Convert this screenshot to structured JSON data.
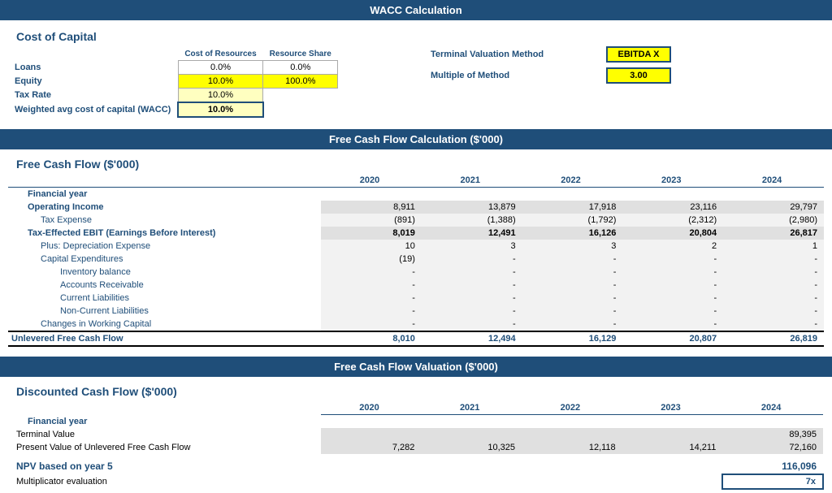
{
  "page": {
    "main_title": "WACC Calculation",
    "fcf_section_title": "Free Cash Flow Calculation ($'000)",
    "valuation_section_title": "Free Cash Flow Valuation ($'000)"
  },
  "wacc": {
    "subtitle": "Cost of Capital",
    "col_headers": {
      "cost_of_resources": "Cost of Resources",
      "resource_share": "Resource Share"
    },
    "rows": [
      {
        "label": "Loans",
        "cost": "0.0%",
        "share": "0.0%"
      },
      {
        "label": "Equity",
        "cost": "10.0%",
        "share": "100.0%"
      },
      {
        "label": "Tax Rate",
        "cost": "10.0%",
        "share": ""
      },
      {
        "label": "Weighted avg cost of capital (WACC)",
        "cost": "10.0%",
        "share": ""
      }
    ],
    "terminal_valuation_label": "Terminal Valuation Method",
    "terminal_valuation_value": "EBITDA X",
    "multiple_of_method_label": "Multiple of Method",
    "multiple_of_method_value": "3.00"
  },
  "fcf": {
    "subtitle": "Free Cash Flow ($'000)",
    "years": [
      "2020",
      "2021",
      "2022",
      "2023",
      "2024"
    ],
    "rows": [
      {
        "label": "Financial year",
        "values": [
          "",
          "",
          "",
          "",
          ""
        ],
        "type": "year-header",
        "indent": 0
      },
      {
        "label": "Operating Income",
        "values": [
          "8,911",
          "13,879",
          "17,918",
          "23,116",
          "29,797"
        ],
        "type": "bold",
        "indent": 1
      },
      {
        "label": "Tax Expense",
        "values": [
          "(891)",
          "(1,388)",
          "(1,792)",
          "(2,312)",
          "(2,980)"
        ],
        "type": "normal",
        "indent": 2
      },
      {
        "label": "Tax-Effected EBIT (Earnings Before Interest)",
        "values": [
          "8,019",
          "12,491",
          "16,126",
          "20,804",
          "26,817"
        ],
        "type": "bold-sub",
        "indent": 1
      },
      {
        "label": "Plus: Depreciation Expense",
        "values": [
          "10",
          "3",
          "3",
          "2",
          "1"
        ],
        "type": "normal",
        "indent": 2
      },
      {
        "label": "Capital Expenditures",
        "values": [
          "(19)",
          "-",
          "-",
          "-",
          "-"
        ],
        "type": "normal",
        "indent": 2
      },
      {
        "label": "Inventory balance",
        "values": [
          "-",
          "-",
          "-",
          "-",
          "-"
        ],
        "type": "normal",
        "indent": 3
      },
      {
        "label": "Accounts Receivable",
        "values": [
          "-",
          "-",
          "-",
          "-",
          "-"
        ],
        "type": "normal",
        "indent": 3
      },
      {
        "label": "Current Liabilities",
        "values": [
          "-",
          "-",
          "-",
          "-",
          "-"
        ],
        "type": "normal",
        "indent": 3
      },
      {
        "label": "Non-Current Liabilities",
        "values": [
          "-",
          "-",
          "-",
          "-",
          "-"
        ],
        "type": "normal",
        "indent": 3
      },
      {
        "label": "Changes in Working Capital",
        "values": [
          "-",
          "-",
          "-",
          "-",
          "-"
        ],
        "type": "normal",
        "indent": 2
      },
      {
        "label": "Unlevered Free Cash Flow",
        "values": [
          "8,010",
          "12,494",
          "16,129",
          "20,807",
          "26,819"
        ],
        "type": "total",
        "indent": 0
      }
    ]
  },
  "dcf": {
    "subtitle": "Discounted Cash Flow ($'000)",
    "years": [
      "2020",
      "2021",
      "2022",
      "2023",
      "2024"
    ],
    "rows": [
      {
        "label": "Financial year",
        "type": "year-header"
      },
      {
        "label": "Terminal Value",
        "values": [
          "",
          "",
          "",
          "",
          "89,395"
        ],
        "type": "normal"
      },
      {
        "label": "Present Value of Unlevered Free Cash Flow",
        "values": [
          "7,282",
          "10,325",
          "12,118",
          "14,211",
          "72,160"
        ],
        "type": "normal"
      },
      {
        "label": "",
        "values": [
          "",
          "",
          "",
          "",
          ""
        ],
        "type": "spacer"
      },
      {
        "label": "NPV based on year 5",
        "values": [
          "",
          "",
          "",
          "",
          "116,096"
        ],
        "type": "npv"
      },
      {
        "label": "Multiplicator evaluation",
        "values": [
          "",
          "",
          "",
          "",
          "7x"
        ],
        "type": "multi"
      }
    ]
  }
}
